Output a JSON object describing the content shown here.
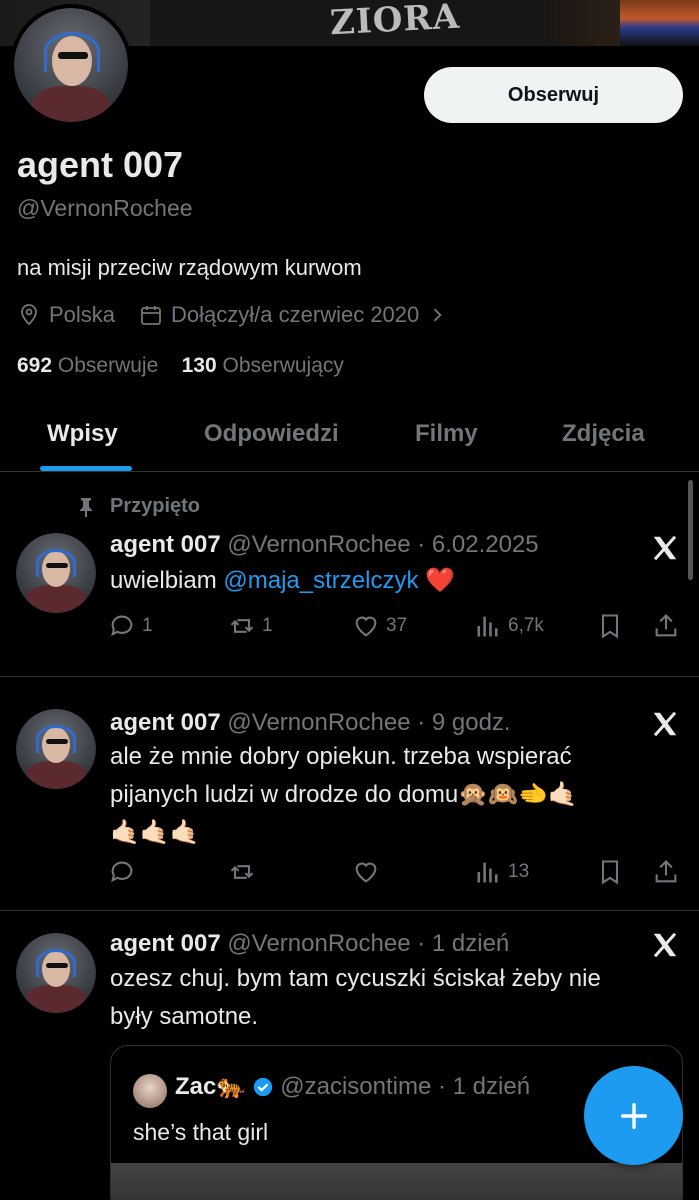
{
  "banner": {
    "shirt_text": "ZIORA"
  },
  "profile": {
    "follow_label": "Obserwuj",
    "display_name": "agent 007",
    "handle": "@VernonRochee",
    "bio": "na misji przeciw rządowym kurwom",
    "location": "Polska",
    "joined": "Dołączył/a czerwiec 2020",
    "following_count": "692",
    "following_label": "Obserwuje",
    "followers_count": "130",
    "followers_label": "Obserwujący"
  },
  "tabs": [
    {
      "label": "Wpisy",
      "active": true
    },
    {
      "label": "Odpowiedzi",
      "active": false
    },
    {
      "label": "Filmy",
      "active": false
    },
    {
      "label": "Zdjęcia",
      "active": false
    }
  ],
  "tweets": [
    {
      "pinned_label": "Przypięto",
      "name": "agent 007",
      "handle_time": "@VernonRochee · 6.02.2025",
      "text_prefix": "uwielbiam ",
      "mention": "@maja_strzelczyk",
      "text_suffix": " ❤️",
      "replies": "1",
      "retweets": "1",
      "likes": "37",
      "views": "6,7k"
    },
    {
      "name": "agent 007",
      "handle_time": "@VernonRochee · 9 godz.",
      "text_line1": "ale że mnie dobry opiekun. trzeba wspierać",
      "text_line2": "pijanych ludzi w drodze do domu🙊🙉🫲🤙🏻",
      "text_line3": "🤙🏻🤙🏻🤙🏻",
      "replies": "",
      "retweets": "",
      "likes": "",
      "views": "13"
    },
    {
      "name": "agent 007",
      "handle_time": "@VernonRochee · 1 dzień",
      "text_line1": "ozesz chuj. bym tam cycuszki ściskał żeby nie",
      "text_line2": "były samotne.",
      "quote": {
        "name": "Zac🐅",
        "handle_time": "@zacisontime · 1 dzień",
        "text": "she’s that girl"
      }
    }
  ],
  "colors": {
    "accent": "#1d9bf0",
    "muted": "#71767b",
    "text": "#e7e9ea",
    "bg": "#000000",
    "divider": "#2f3336"
  }
}
